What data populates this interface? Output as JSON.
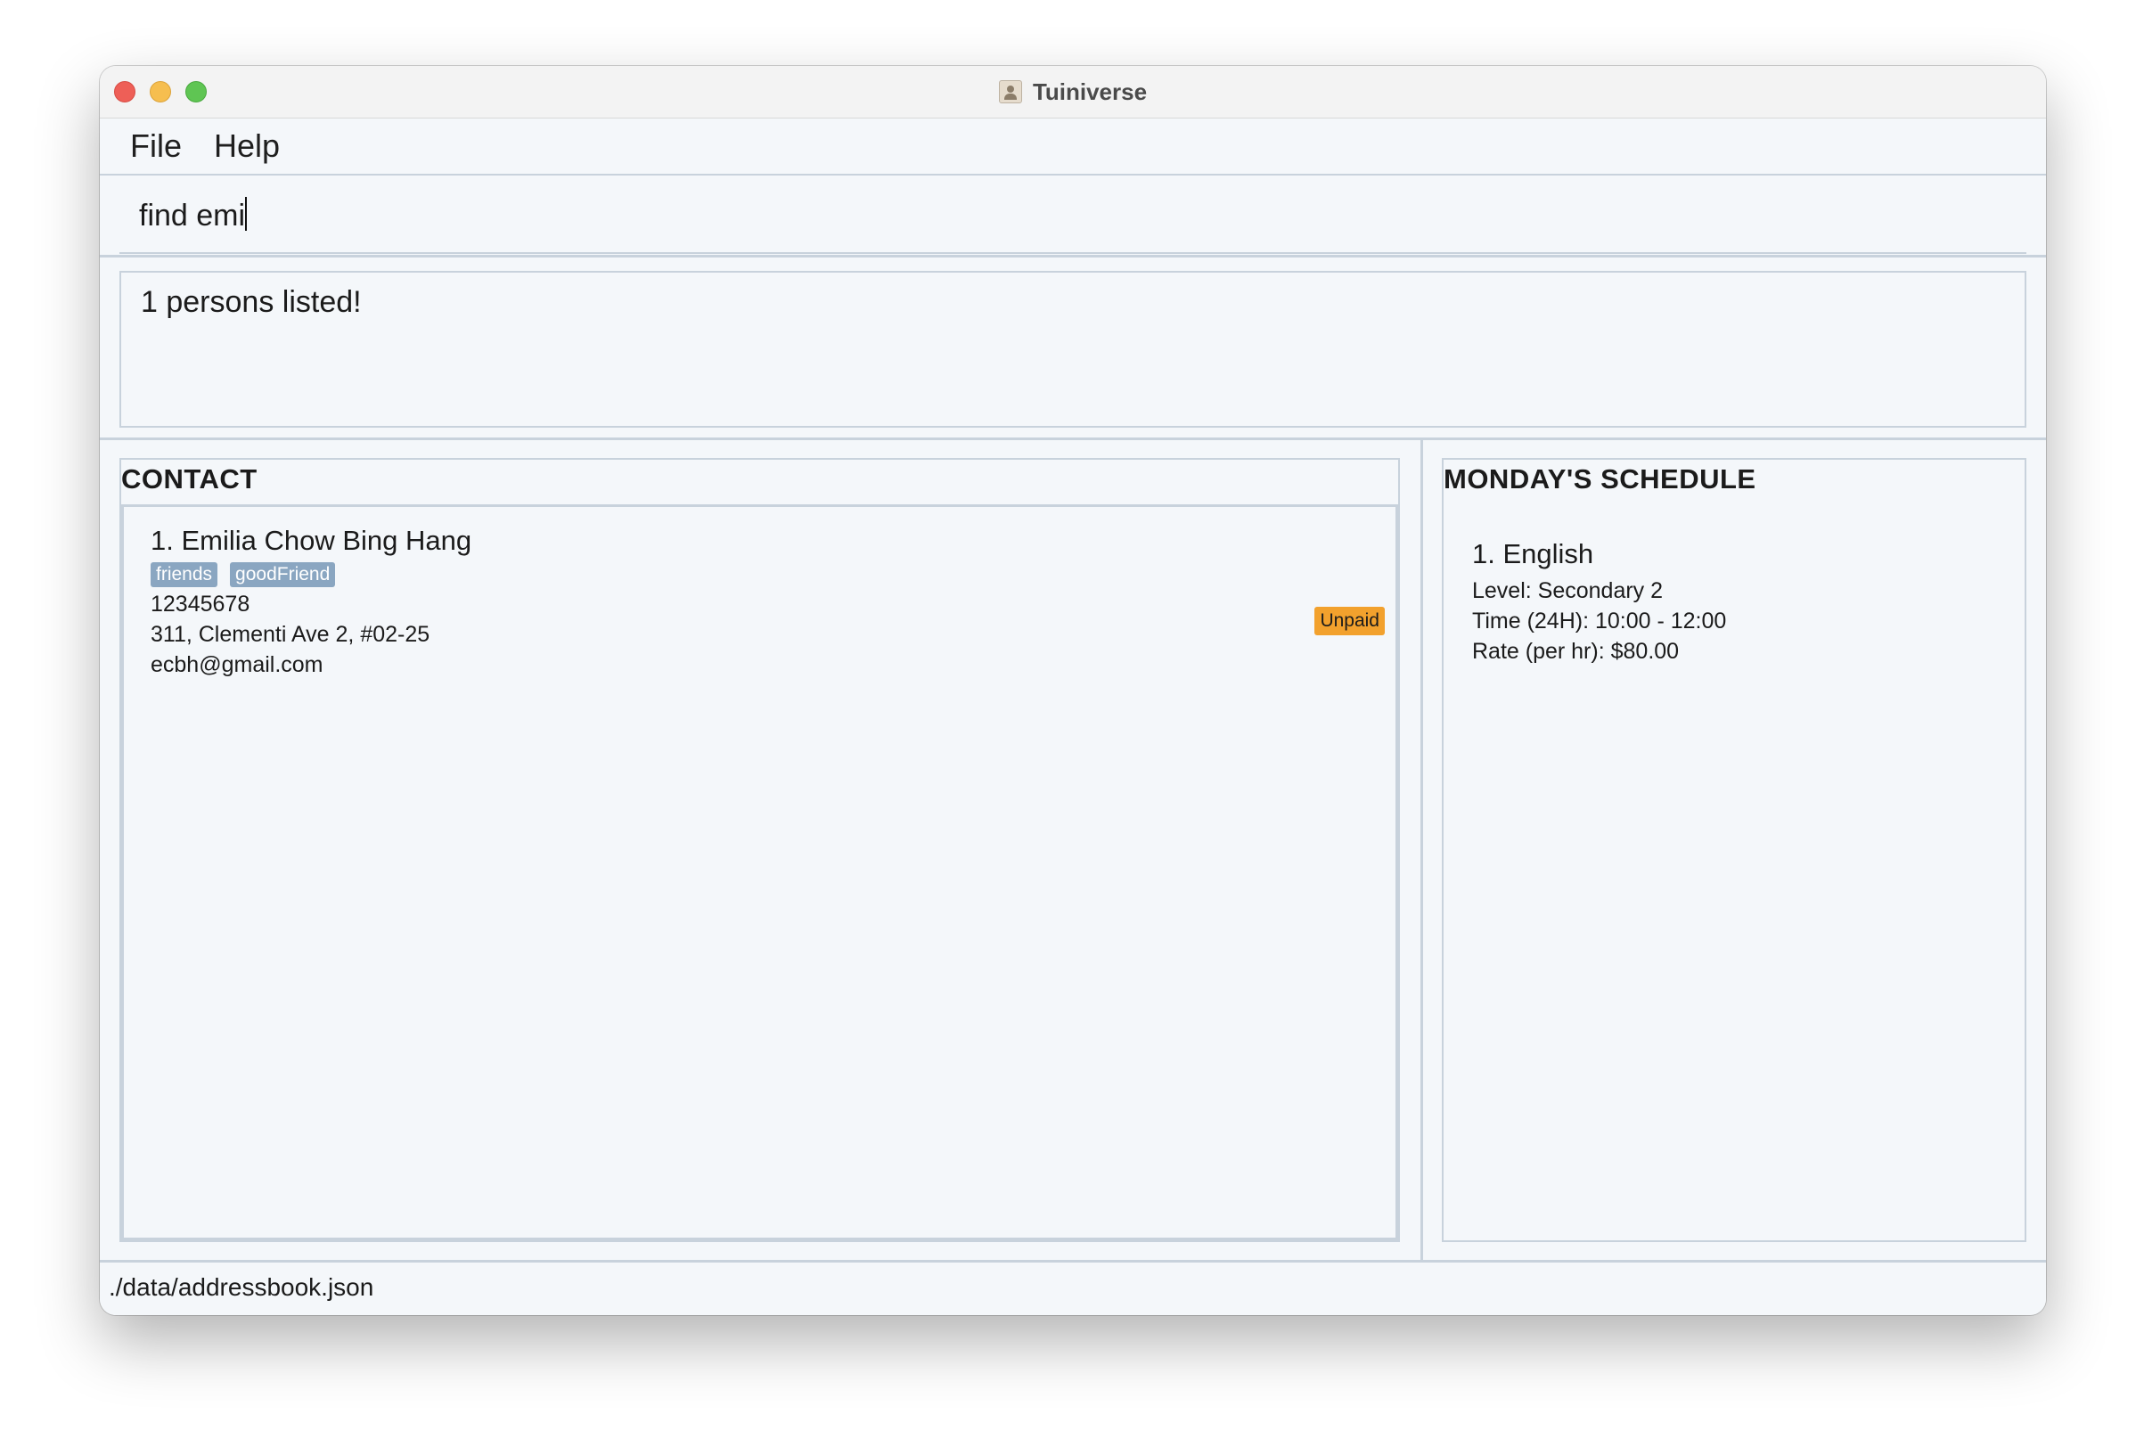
{
  "window": {
    "title": "Tuiniverse"
  },
  "menu": {
    "file": "File",
    "help": "Help"
  },
  "command": {
    "value": "find emi"
  },
  "result": {
    "message": "1 persons listed!"
  },
  "contact": {
    "heading": "CONTACT",
    "persons": [
      {
        "name": "1. Emilia Chow Bing Hang",
        "tags": [
          "friends",
          "goodFriend"
        ],
        "phone": "12345678",
        "address": "311, Clementi Ave 2, #02-25",
        "email": "ecbh@gmail.com",
        "payment_status": "Unpaid"
      }
    ]
  },
  "schedule": {
    "heading": "MONDAY'S SCHEDULE",
    "entries": [
      {
        "name": "1. English",
        "level": "Level: Secondary 2",
        "time": "Time (24H): 10:00 - 12:00",
        "rate": "Rate (per hr): $80.00"
      }
    ]
  },
  "status": {
    "file_path": "./data/addressbook.json"
  },
  "colors": {
    "background": "#f4f7fa",
    "border": "#c8d2dc",
    "tag": "#8aa6c1",
    "unpaid_badge": "#f2a12d"
  }
}
